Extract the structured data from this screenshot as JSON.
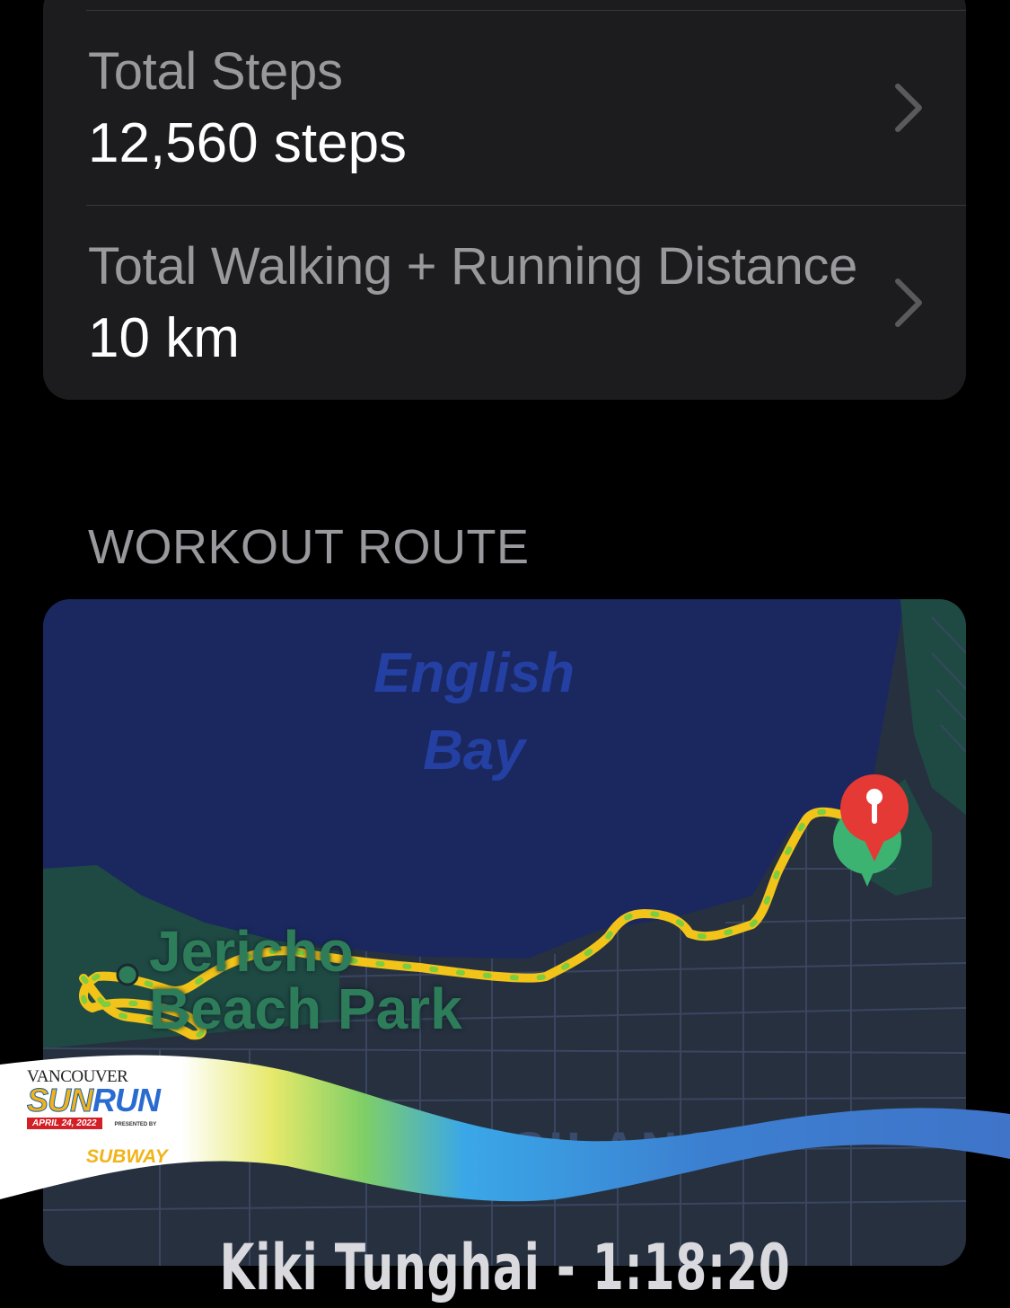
{
  "summary": {
    "rows": [
      {
        "label": "Total Steps",
        "value": "12,560 steps"
      },
      {
        "label": "Total Walking + Running Distance",
        "value": "10 km"
      }
    ]
  },
  "route": {
    "section_title": "WORKOUT ROUTE",
    "map": {
      "water_label": "English\nBay",
      "park_label": "Jericho\nBeach Park",
      "district_label": "KITSILANO"
    },
    "colors": {
      "water": "#1b2860",
      "route": "#f2c318",
      "route_dots": "#7ccd3f",
      "end_pin": "#e53935",
      "start_pin": "#3cb371"
    }
  },
  "overlay": {
    "event_logo": {
      "vancouver": "VANCOUVER",
      "sun": "SUN",
      "run": "RUN",
      "date": "APRIL 24, 2022",
      "presented_by": "PRESENTED BY",
      "sponsor": "SUBWAY"
    },
    "caption": "Kiki Tunghai - 1:18:20"
  }
}
